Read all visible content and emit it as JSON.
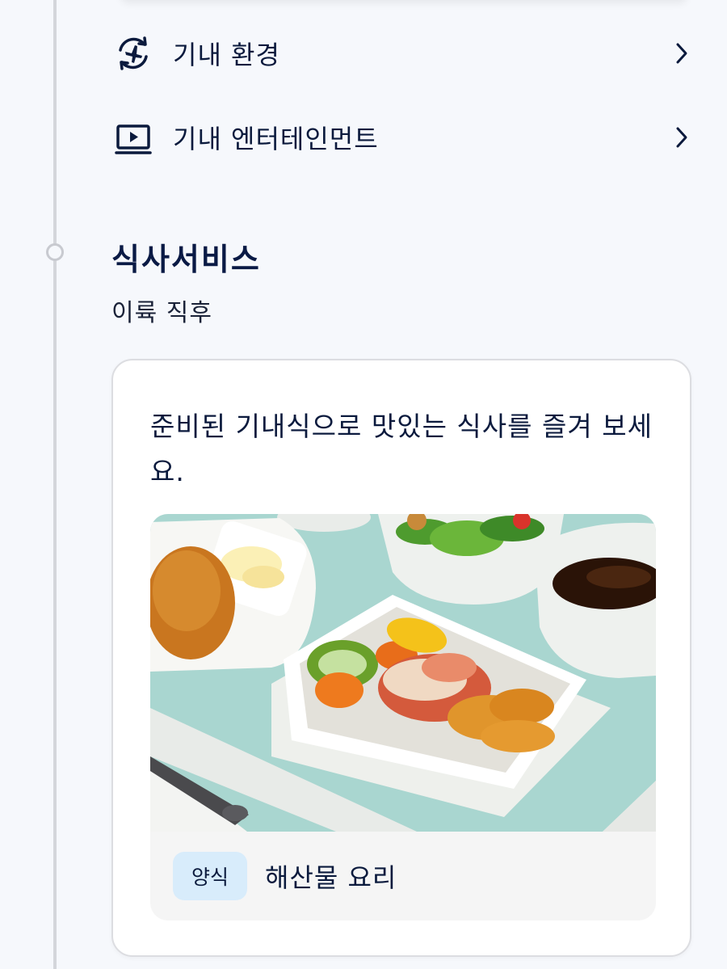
{
  "rows": [
    {
      "label": "기내 환경",
      "icon": "plane-cycle-icon"
    },
    {
      "label": "기내 엔터테인먼트",
      "icon": "play-screen-icon"
    }
  ],
  "meal_section": {
    "title": "식사서비스",
    "timing": "이륙 직후",
    "description": "준비된 기내식으로 맛있는 식사를 즐겨 보세요.",
    "meal": {
      "badge": "양식",
      "name": "해산물 요리"
    }
  },
  "colors": {
    "navy": "#0b1a3d",
    "badge_bg": "#d8ecfb",
    "timeline": "#d4d6db"
  }
}
